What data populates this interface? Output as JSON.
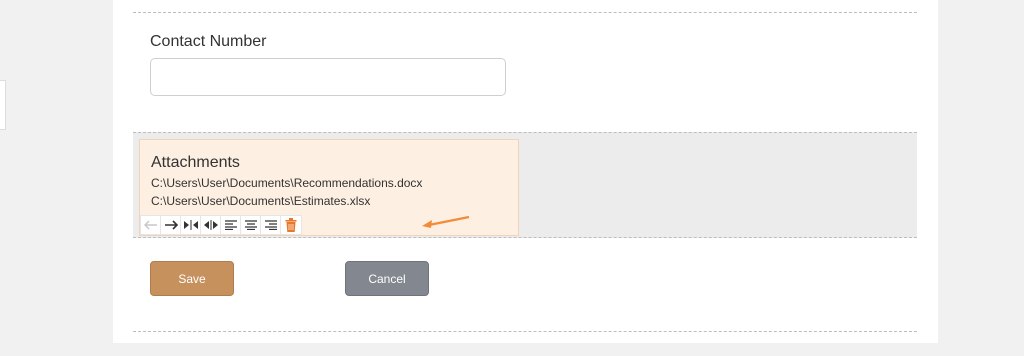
{
  "form": {
    "contact_label": "Contact Number",
    "contact_value": "",
    "attachments_title": "Attachments",
    "attachments": [
      "C:\\Users\\User\\Documents\\Recommendations.docx",
      "C:\\Users\\User\\Documents\\Estimates.xlsx"
    ],
    "toolbar_icons": [
      "arrow-left-icon",
      "arrow-right-icon",
      "collapse-icon",
      "expand-icon",
      "align-left-icon",
      "align-center-icon",
      "align-right-icon",
      "trash-icon"
    ],
    "save_label": "Save",
    "cancel_label": "Cancel"
  },
  "colors": {
    "save": "#c7915e",
    "cancel": "#838890",
    "attachment_bg": "#fdefe2",
    "annotation_arrow": "#f28c38",
    "trash": "#e8782a"
  }
}
